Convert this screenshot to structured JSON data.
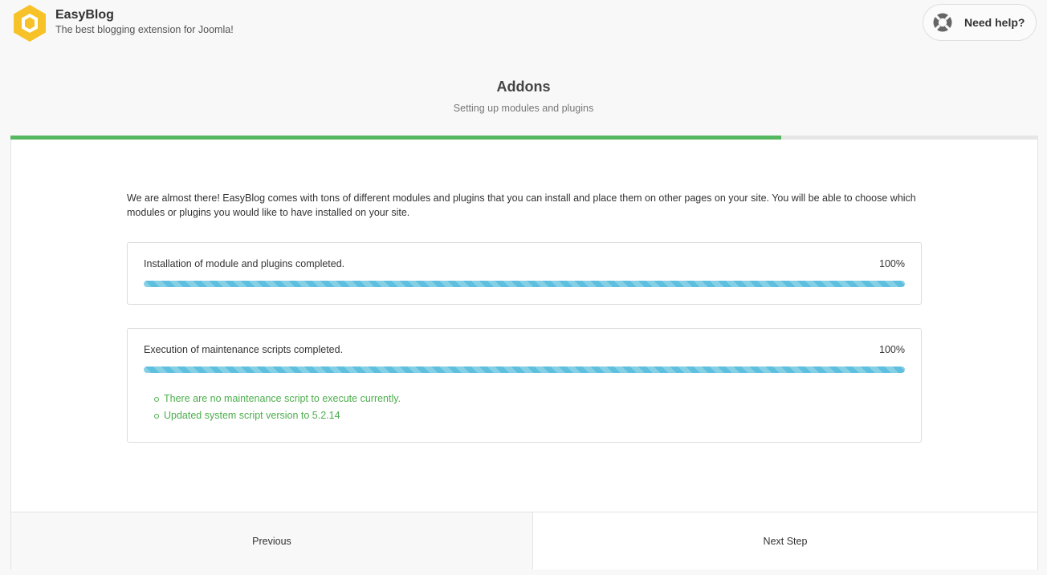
{
  "brand": {
    "name": "EasyBlog",
    "tagline": "The best blogging extension for Joomla!",
    "logo_icon": "hexagon-logo-icon",
    "logo_color": "#f7c228"
  },
  "help": {
    "label": "Need help?",
    "icon": "lifebuoy-icon"
  },
  "step": {
    "title": "Addons",
    "subtitle": "Setting up modules and plugins",
    "progress_fraction": 0.75,
    "progress_color": "#55b860"
  },
  "intro": "We are almost there! EasyBlog comes with tons of different modules and plugins that you can install and place them on other pages on your site. You will be able to choose which modules or plugins you would like to have installed on your site.",
  "tasks": [
    {
      "label": "Installation of module and plugins completed.",
      "percent_label": "100%",
      "progress": 1.0
    },
    {
      "label": "Execution of maintenance scripts completed.",
      "percent_label": "100%",
      "progress": 1.0,
      "logs": [
        "There are no maintenance script to execute currently.",
        "Updated system script version to 5.2.14"
      ]
    }
  ],
  "footer": {
    "previous_label": "Previous",
    "next_label": "Next Step"
  },
  "colors": {
    "bar": "#5ec0de",
    "log_text": "#4cae4c"
  }
}
